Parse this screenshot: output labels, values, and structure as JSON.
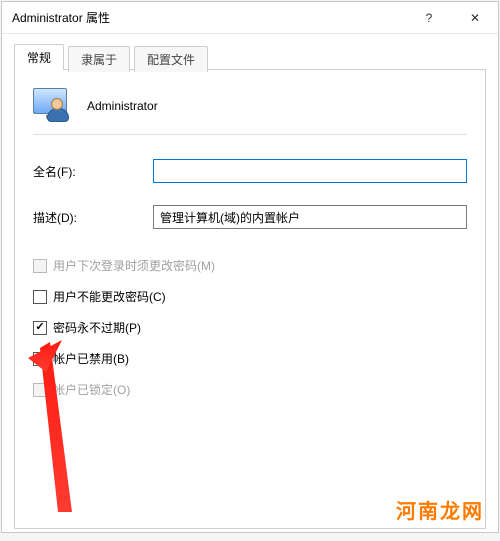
{
  "window": {
    "title": "Administrator 属性"
  },
  "tabs": {
    "general": "常规",
    "member_of": "隶属于",
    "profile": "配置文件"
  },
  "header": {
    "username": "Administrator"
  },
  "fields": {
    "fullname_label": "全名(F):",
    "fullname_value": "",
    "description_label": "描述(D):",
    "description_value": "管理计算机(域)的内置帐户"
  },
  "checks": {
    "must_change": "用户下次登录时须更改密码(M)",
    "cannot_change": "用户不能更改密码(C)",
    "never_expires": "密码永不过期(P)",
    "disabled": "帐户已禁用(B)",
    "locked": "帐户已锁定(O)"
  },
  "watermark": "河南龙网"
}
